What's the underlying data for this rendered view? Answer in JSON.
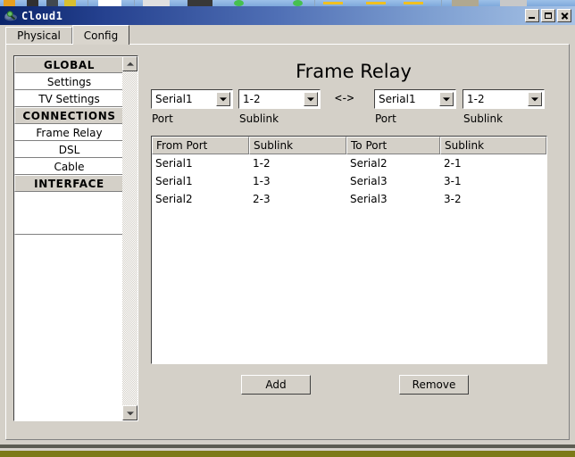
{
  "window": {
    "title": "Cloud1",
    "icon": "cloud-magnifier-icon",
    "controls": {
      "minimize": "minimize-button",
      "maximize": "maximize-button",
      "close": "close-button"
    }
  },
  "tabs": [
    {
      "label": "Physical",
      "active": false
    },
    {
      "label": "Config",
      "active": true
    }
  ],
  "sidebar": {
    "items": [
      {
        "label": "GLOBAL",
        "type": "header"
      },
      {
        "label": "Settings",
        "type": "item"
      },
      {
        "label": "TV Settings",
        "type": "item"
      },
      {
        "label": "CONNECTIONS",
        "type": "header"
      },
      {
        "label": "Frame Relay",
        "type": "item"
      },
      {
        "label": "DSL",
        "type": "item"
      },
      {
        "label": "Cable",
        "type": "item"
      },
      {
        "label": "INTERFACE",
        "type": "header"
      },
      {
        "label": "",
        "type": "blank"
      }
    ],
    "scrollbar": {
      "up_icon": "scroll-up-arrow-icon",
      "down_icon": "scroll-down-arrow-icon"
    }
  },
  "main": {
    "title": "Frame Relay",
    "link_arrow": "<->",
    "selectors": {
      "from_port": {
        "value": "Serial1",
        "label": "Port"
      },
      "from_sublink": {
        "value": "1-2",
        "label": "Sublink"
      },
      "to_port": {
        "value": "Serial1",
        "label": "Port"
      },
      "to_sublink": {
        "value": "1-2",
        "label": "Sublink"
      }
    },
    "table": {
      "columns": [
        "From Port",
        "Sublink",
        "To Port",
        "Sublink"
      ],
      "rows": [
        [
          "Serial1",
          "1-2",
          "Serial2",
          "2-1"
        ],
        [
          "Serial1",
          "1-3",
          "Serial3",
          "3-1"
        ],
        [
          "Serial2",
          "2-3",
          "Serial3",
          "3-2"
        ]
      ]
    },
    "buttons": {
      "add": "Add",
      "remove": "Remove"
    }
  },
  "colors": {
    "face": "#d4d0c8",
    "title_start": "#0a246a",
    "title_end": "#a7c3e6",
    "desktop": "#7d7a18"
  }
}
